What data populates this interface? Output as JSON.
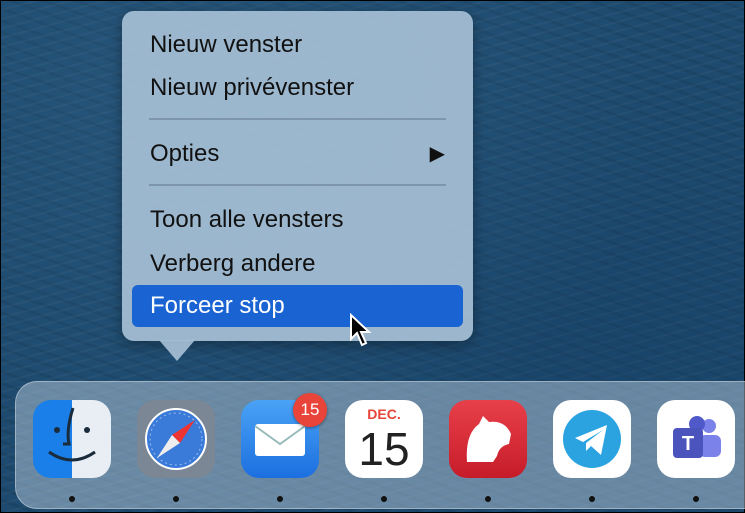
{
  "context_menu": {
    "items": [
      {
        "label": "Nieuw venster"
      },
      {
        "label": "Nieuw privévenster"
      },
      {
        "label": "Opties",
        "submenu_arrow": "▶"
      },
      {
        "label": "Toon alle vensters"
      },
      {
        "label": "Verberg andere"
      },
      {
        "label": "Forceer stop",
        "highlighted": true
      }
    ],
    "highlight_color": "#1a63d3"
  },
  "dock": {
    "apps": [
      {
        "name": "finder-icon",
        "running": true
      },
      {
        "name": "safari-icon",
        "running": true
      },
      {
        "name": "mail-icon",
        "running": true,
        "badge": "15"
      },
      {
        "name": "calendar-icon",
        "running": true,
        "month": "DEC.",
        "day": "15"
      },
      {
        "name": "bear-icon",
        "running": true
      },
      {
        "name": "telegram-icon",
        "running": true
      },
      {
        "name": "teams-icon",
        "running": true
      }
    ]
  }
}
